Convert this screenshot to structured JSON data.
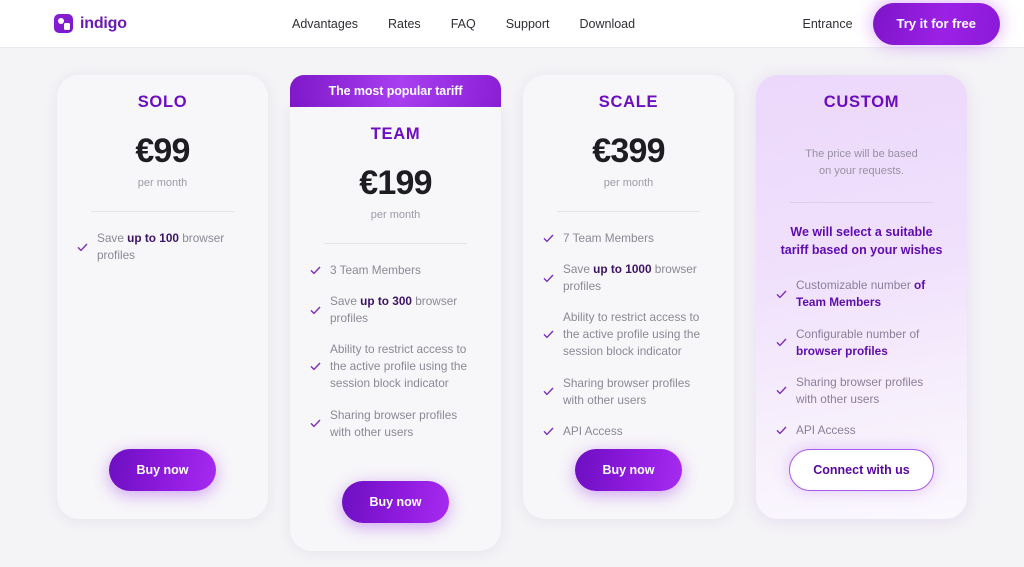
{
  "header": {
    "brand": {
      "name": "indigo",
      "icon": "indigo-logo-icon"
    },
    "nav": [
      {
        "label": "Advantages"
      },
      {
        "label": "Rates"
      },
      {
        "label": "FAQ"
      },
      {
        "label": "Support"
      },
      {
        "label": "Download"
      }
    ],
    "entrance_label": "Entrance",
    "cta_label": "Try it for free"
  },
  "colors": {
    "accent": "#8a19d8",
    "accent_dark": "#6d0fc0",
    "page_background": "#f4f3f6",
    "card_background": "#f7f6f9",
    "custom_card_background": "#ecd8fb",
    "muted_text": "#8b8a94"
  },
  "plans": [
    {
      "id": "solo",
      "title": "SOLO",
      "price": "€99",
      "period": "per month",
      "banner": null,
      "features": [
        {
          "parts": [
            {
              "t": "Save ",
              "b": false
            },
            {
              "t": "up to 100",
              "b": true
            },
            {
              "t": " browser profiles",
              "b": false
            }
          ]
        }
      ],
      "button": {
        "label": "Buy now",
        "style": "solid"
      }
    },
    {
      "id": "team",
      "title": "TEAM",
      "price": "€199",
      "period": "per month",
      "banner": "The most popular tariff",
      "features": [
        {
          "parts": [
            {
              "t": "3 Team Members",
              "b": false
            }
          ]
        },
        {
          "parts": [
            {
              "t": "Save ",
              "b": false
            },
            {
              "t": "up to 300",
              "b": true
            },
            {
              "t": " browser profiles",
              "b": false
            }
          ]
        },
        {
          "parts": [
            {
              "t": "Ability to restrict access to the active profile using the session block indicator",
              "b": false
            }
          ]
        },
        {
          "parts": [
            {
              "t": "Sharing browser profiles with other users",
              "b": false
            }
          ]
        }
      ],
      "button": {
        "label": "Buy now",
        "style": "solid"
      }
    },
    {
      "id": "scale",
      "title": "SCALE",
      "price": "€399",
      "period": "per month",
      "banner": null,
      "features": [
        {
          "parts": [
            {
              "t": "7 Team Members",
              "b": false
            }
          ]
        },
        {
          "parts": [
            {
              "t": "Save ",
              "b": false
            },
            {
              "t": "up to 1000",
              "b": true
            },
            {
              "t": " browser profiles",
              "b": false
            }
          ]
        },
        {
          "parts": [
            {
              "t": "Ability to restrict access to the active profile using the session block indicator",
              "b": false
            }
          ]
        },
        {
          "parts": [
            {
              "t": "Sharing browser profiles with other users",
              "b": false
            }
          ]
        },
        {
          "parts": [
            {
              "t": "API Access",
              "b": false
            }
          ]
        }
      ],
      "button": {
        "label": "Buy now",
        "style": "solid"
      }
    },
    {
      "id": "custom",
      "title": "CUSTOM",
      "price": null,
      "period": null,
      "price_note": "The price will be based\non your requests.",
      "headline": "We will select a suitable tariff based on your wishes",
      "banner": null,
      "features": [
        {
          "parts": [
            {
              "t": "Customizable number ",
              "b": false
            },
            {
              "t": "of Team Members",
              "b": true
            }
          ]
        },
        {
          "parts": [
            {
              "t": "Configurable number of ",
              "b": false
            },
            {
              "t": "browser profiles",
              "b": true
            }
          ]
        },
        {
          "parts": [
            {
              "t": "Sharing browser profiles with other users",
              "b": false
            }
          ]
        },
        {
          "parts": [
            {
              "t": "API Access",
              "b": false
            }
          ]
        }
      ],
      "button": {
        "label": "Connect with us",
        "style": "outline"
      }
    }
  ]
}
